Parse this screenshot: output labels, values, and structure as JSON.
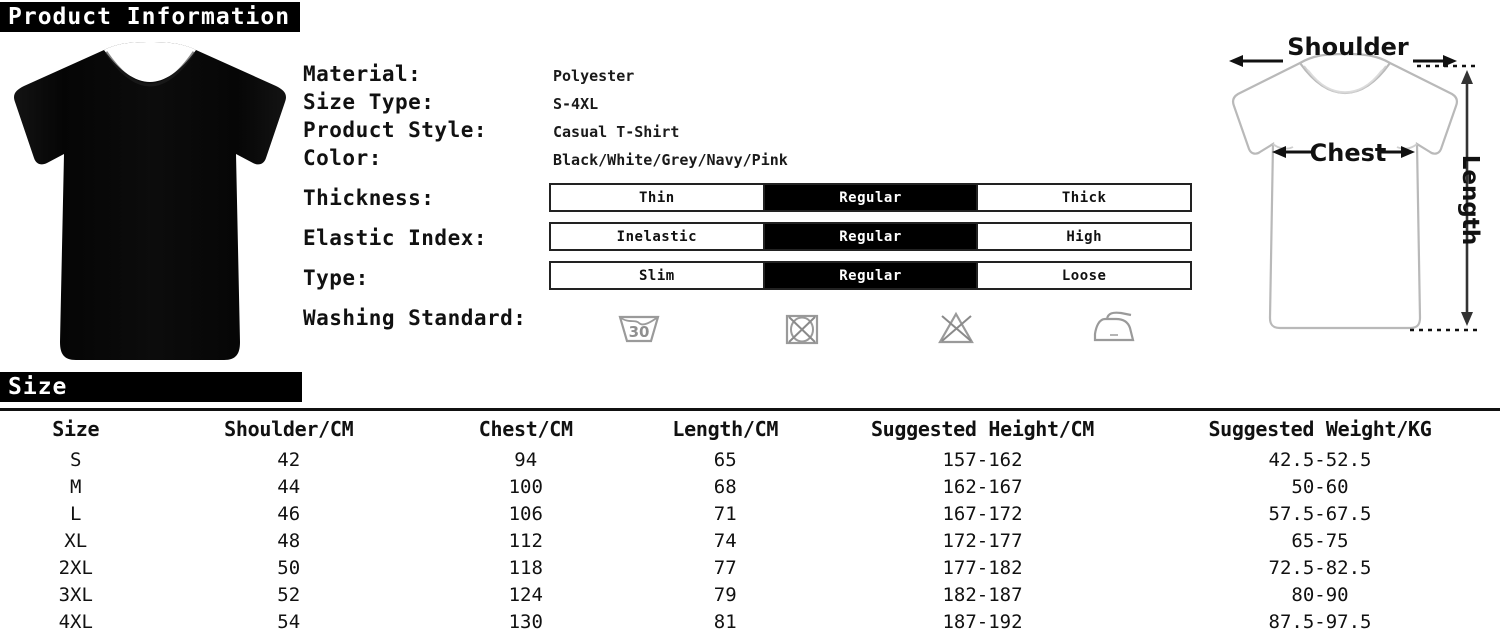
{
  "sections": {
    "product_information": "Product Information",
    "size": "Size"
  },
  "product_photo": {
    "alt": "black-t-shirt-front-view",
    "color": "#0a0a0a"
  },
  "specs": [
    {
      "label": "Material:",
      "value": "Polyester"
    },
    {
      "label": "Size Type:",
      "value": "S-4XL"
    },
    {
      "label": "Product Style:",
      "value": "Casual T-Shirt"
    },
    {
      "label": "Color:",
      "value": "Black/White/Grey/Navy/Pink"
    }
  ],
  "options": [
    {
      "label": "Thickness:",
      "choices": [
        "Thin",
        "Regular",
        "Thick"
      ],
      "selected": "Regular"
    },
    {
      "label": "Elastic Index:",
      "choices": [
        "Inelastic",
        "Regular",
        "High"
      ],
      "selected": "Regular"
    },
    {
      "label": "Type:",
      "choices": [
        "Slim",
        "Regular",
        "Loose"
      ],
      "selected": "Regular"
    }
  ],
  "washing": {
    "label": "Washing Standard:",
    "icons": [
      {
        "name": "wash-30-icon",
        "text": "30"
      },
      {
        "name": "do-not-tumble-dry-icon",
        "text": ""
      },
      {
        "name": "do-not-bleach-icon",
        "text": ""
      },
      {
        "name": "iron-icon",
        "text": ""
      }
    ]
  },
  "diagram": {
    "shoulder_label": "Shoulder",
    "chest_label": "Chest",
    "length_label": "Length"
  },
  "size_table": {
    "headers": [
      "Size",
      "Shoulder/CM",
      "Chest/CM",
      "Length/CM",
      "Suggested Height/CM",
      "Suggested Weight/KG"
    ],
    "rows": [
      [
        "S",
        "42",
        "94",
        "65",
        "157-162",
        "42.5-52.5"
      ],
      [
        "M",
        "44",
        "100",
        "68",
        "162-167",
        "50-60"
      ],
      [
        "L",
        "46",
        "106",
        "71",
        "167-172",
        "57.5-67.5"
      ],
      [
        "XL",
        "48",
        "112",
        "74",
        "172-177",
        "65-75"
      ],
      [
        "2XL",
        "50",
        "118",
        "77",
        "177-182",
        "72.5-82.5"
      ],
      [
        "3XL",
        "52",
        "124",
        "79",
        "182-187",
        "80-90"
      ],
      [
        "4XL",
        "54",
        "130",
        "81",
        "187-192",
        "87.5-97.5"
      ]
    ]
  },
  "chart_data": {
    "type": "table",
    "title": "Size",
    "categories": [
      "S",
      "M",
      "L",
      "XL",
      "2XL",
      "3XL",
      "4XL"
    ],
    "series": [
      {
        "name": "Shoulder/CM",
        "values": [
          42,
          44,
          46,
          48,
          50,
          52,
          54
        ]
      },
      {
        "name": "Chest/CM",
        "values": [
          94,
          100,
          106,
          112,
          118,
          124,
          130
        ]
      },
      {
        "name": "Length/CM",
        "values": [
          65,
          68,
          71,
          74,
          77,
          79,
          81
        ]
      }
    ],
    "ranges": [
      {
        "name": "Suggested Height/CM",
        "values": [
          "157-162",
          "162-167",
          "167-172",
          "172-177",
          "177-182",
          "182-187",
          "187-192"
        ]
      },
      {
        "name": "Suggested Weight/KG",
        "values": [
          "42.5-52.5",
          "50-60",
          "57.5-67.5",
          "65-75",
          "72.5-82.5",
          "80-90",
          "87.5-97.5"
        ]
      }
    ]
  }
}
